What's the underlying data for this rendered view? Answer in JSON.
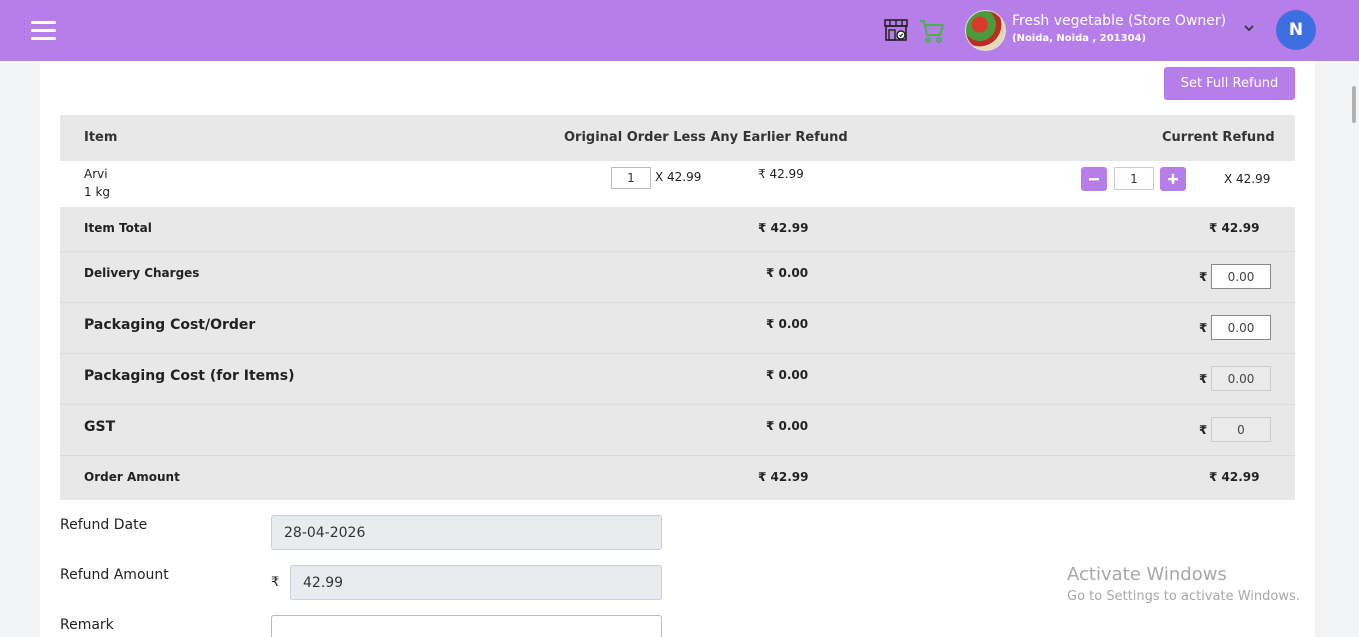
{
  "header": {
    "store_name": "Fresh vegetable (Store Owner)",
    "store_address": "(Noida, Noida , 201304)",
    "user_initial": "N"
  },
  "actions": {
    "full_refund_label": "Set Full Refund"
  },
  "table": {
    "headers": {
      "item": "Item",
      "original": "Original Order Less Any Earlier Refund",
      "current": "Current Refund"
    },
    "item": {
      "name": "Arvi",
      "unit": "1 kg",
      "original_qty": "1",
      "original_price": "X 42.99",
      "original_total": "₹ 42.99",
      "current_qty": "1",
      "current_price": "X 42.99"
    },
    "rows": [
      {
        "label": "Item Total",
        "original": "₹ 42.99",
        "current": "₹ 42.99"
      },
      {
        "label": "Delivery Charges",
        "original": "₹ 0.00",
        "current_symbol": "₹",
        "current_input": "0.00"
      },
      {
        "label": "Packaging Cost/Order",
        "original": "₹ 0.00",
        "current_symbol": "₹",
        "current_input": "0.00"
      },
      {
        "label": "Packaging Cost (for Items)",
        "original": "₹ 0.00",
        "current_symbol": "₹",
        "current_input": "0.00"
      },
      {
        "label": "GST",
        "original": "₹ 0.00",
        "current_symbol": "₹",
        "current_input": "0"
      },
      {
        "label": "Order Amount",
        "original": "₹ 42.99",
        "current": "₹ 42.99"
      }
    ]
  },
  "form": {
    "refund_date_label": "Refund Date",
    "refund_date_value": "28-04-2026",
    "refund_amount_label": "Refund Amount",
    "refund_amount_symbol": "₹",
    "refund_amount_value": "42.99",
    "remark_label": "Remark",
    "remark_value": ""
  },
  "watermark": {
    "title": "Activate Windows",
    "subtitle": "Go to Settings to activate Windows."
  },
  "colors": {
    "accent": "#b57ee8",
    "avatar": "#3e6fe1",
    "cart": "#4caf50"
  }
}
